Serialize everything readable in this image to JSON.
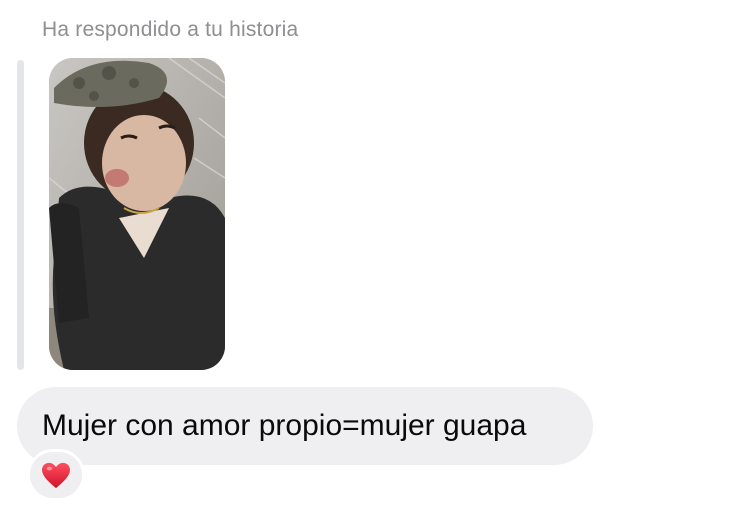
{
  "reply_header": "Ha respondido a tu historia",
  "story": {
    "image": "story-photo"
  },
  "message": {
    "text": "Mujer con amor propio=mujer guapa"
  },
  "reaction": {
    "icon": "heart-icon",
    "color": "#e0245e"
  },
  "colors": {
    "bubble": "#efeff2",
    "header_text": "#8e8e93",
    "quote_bar": "#e4e5e8"
  }
}
